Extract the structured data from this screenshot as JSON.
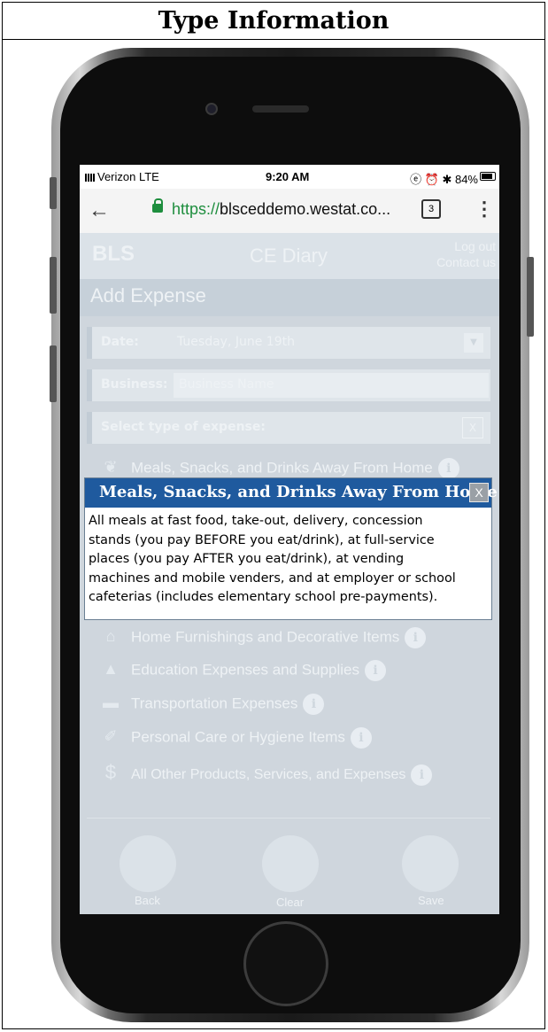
{
  "page": {
    "title": "Type Information"
  },
  "status_bar": {
    "carrier": "Verizon  LTE",
    "time": "9:20 AM",
    "right": "ⓔ ⏰ ✱ 84%"
  },
  "browser": {
    "back": "←",
    "url_protocol": "https://",
    "url_rest": "blsceddemo.westat.co...",
    "tab_count": "3",
    "menu": "⋮"
  },
  "app": {
    "logo": "BLS",
    "title": "CE Diary",
    "links": [
      "Log out",
      "Contact us"
    ],
    "section": "Add Expense",
    "date_label": "Date:",
    "date_value": "Tuesday, June 19th",
    "business_label": "Business:",
    "business_placeholder": "Business Name",
    "type_label": "Select type of expense:",
    "clear_x": "X"
  },
  "categories": [
    {
      "label": "Meals, Snacks, and Drinks Away From Home",
      "icon": "❦"
    },
    {
      "label": "Home Furnishings and Decorative Items",
      "icon": "⌂"
    },
    {
      "label": "Education Expenses and Supplies",
      "icon": "▲"
    },
    {
      "label": "Transportation Expenses",
      "icon": "▬"
    },
    {
      "label": "Personal Care or Hygiene Items",
      "icon": "✐"
    },
    {
      "label": "All Other Products, Services, and Expenses",
      "icon": "$"
    }
  ],
  "info_glyph": "i",
  "bottom": {
    "back": "Back",
    "clear": "Clear",
    "save": "Save"
  },
  "popup": {
    "title": "Meals, Snacks, and Drinks Away From Home",
    "close": "X",
    "lines": [
      "All meals at fast food, take-out, delivery, concession",
      "stands (you pay BEFORE you eat/drink), at full-service",
      "places (you pay AFTER you eat/drink), at vending",
      "machines and mobile venders, and at employer or school",
      "cafeterias (includes elementary school pre-payments)."
    ]
  }
}
